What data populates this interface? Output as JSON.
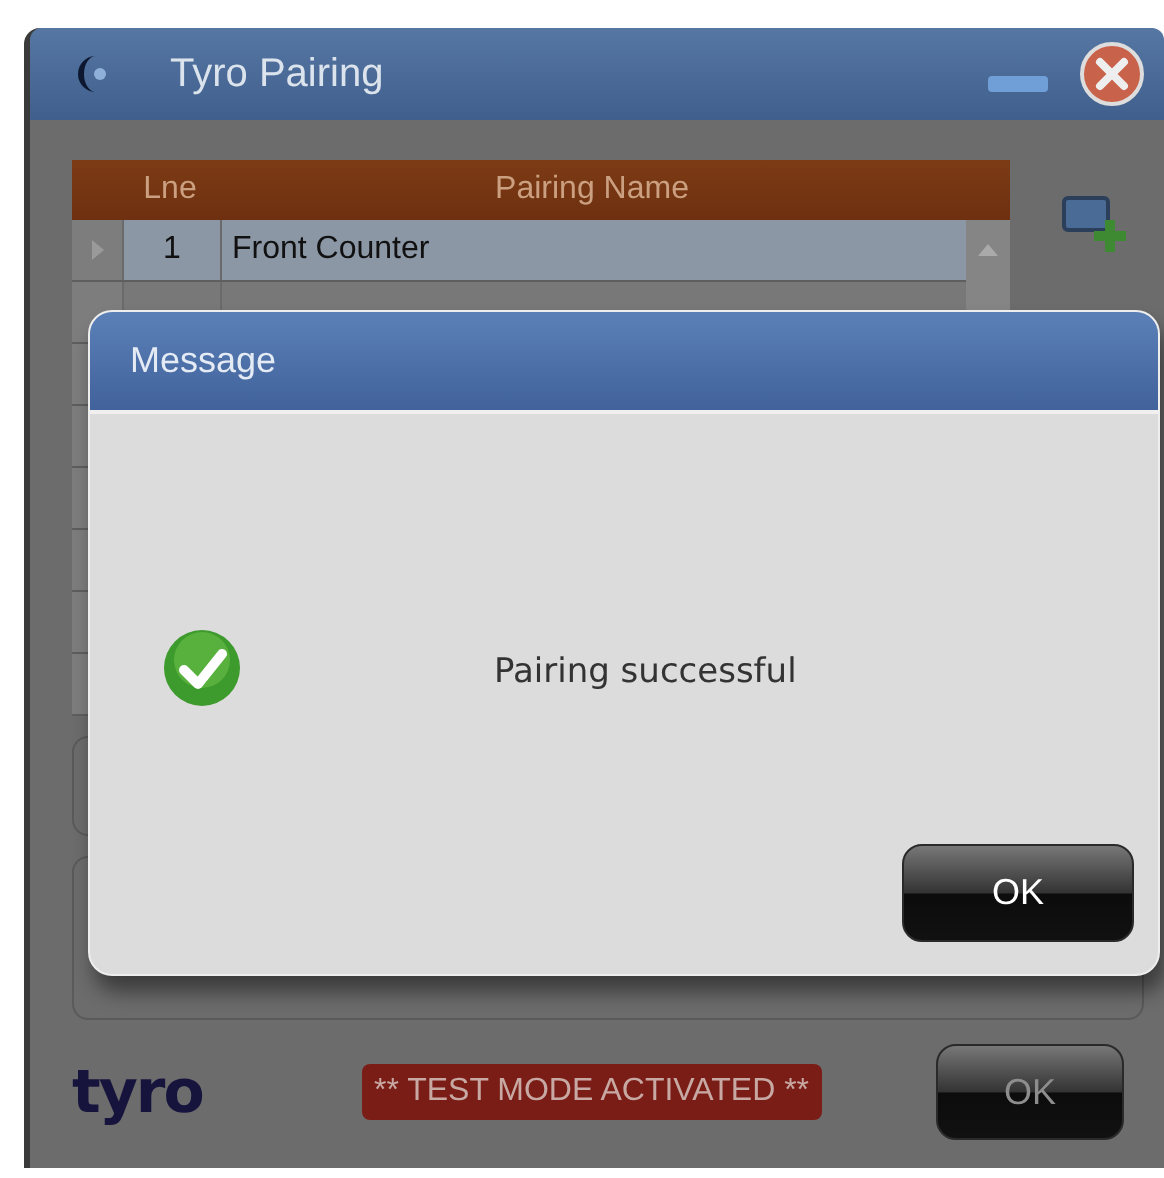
{
  "window": {
    "title": "Tyro Pairing"
  },
  "table": {
    "columns": [
      "Lne",
      "Pairing Name"
    ],
    "rows": [
      {
        "line": "1",
        "name": "Front Counter",
        "selected": true
      }
    ]
  },
  "dialog": {
    "title": "Message",
    "message": "Pairing successful",
    "button": "OK"
  },
  "footer": {
    "logo": "tyro",
    "badge": "** TEST MODE ACTIVATED **",
    "button": "OK"
  }
}
